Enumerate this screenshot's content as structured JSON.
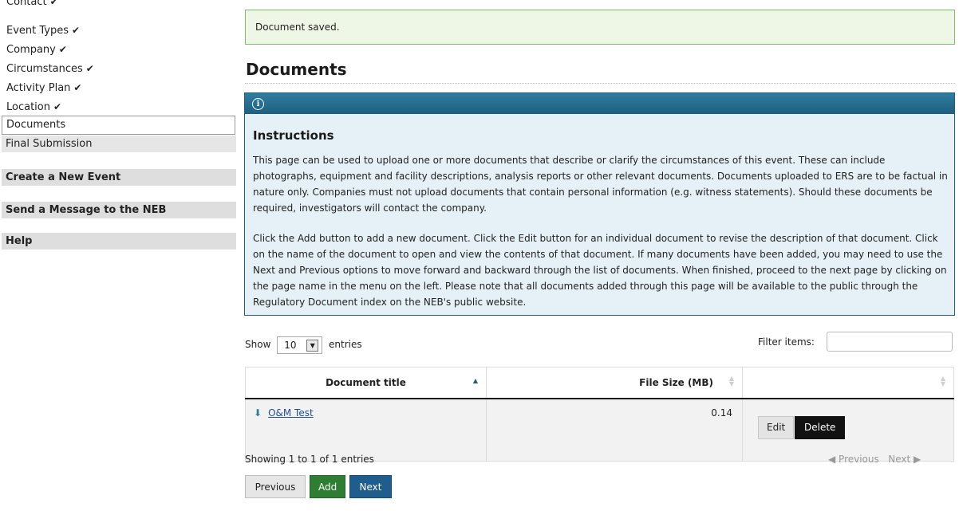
{
  "sidebar": {
    "nav": [
      {
        "label": "Contact",
        "check": "✔"
      },
      {
        "label": "Event Types",
        "check": "✔"
      },
      {
        "label": "Company",
        "check": "✔"
      },
      {
        "label": "Circumstances",
        "check": "✔"
      },
      {
        "label": "Activity Plan",
        "check": "✔"
      },
      {
        "label": "Location",
        "check": "✔"
      },
      {
        "label": "Documents",
        "check": ""
      },
      {
        "label": "Final Submission",
        "check": ""
      }
    ],
    "headings": [
      "Create a New Event",
      "Send a Message to the NEB",
      "Help"
    ]
  },
  "alert": {
    "message": "Document saved."
  },
  "page": {
    "title": "Documents"
  },
  "instructions": {
    "heading": "Instructions",
    "paragraph1": "This page can be used to upload one or more documents that describe or clarify the circumstances of this event. These can include photographs, equipment and facility descriptions, analysis reports or other relevant documents. Documents uploaded to ERS are to be factual in nature only. Companies must not upload documents that contain personal information (e.g. witness statements). Should these documents be required, investigators will contact the company.",
    "paragraph2": "Click the Add button to add a new document. Click the Edit button for an individual document to revise the description of that document. Click on the name of the document to open and view the contents of that document. If many documents have been added, you may need to use the Next and Previous options to move forward and backward through the list of documents. When finished, proceed to the next page by clicking on the page name in the menu on the left. Please note that all documents added through this page will be available to the public through the Regulatory Document index on the NEB's public website."
  },
  "table_controls": {
    "show_label": "Show",
    "entries_value": "10",
    "entries_label": "entries",
    "filter_label": "Filter items:"
  },
  "table": {
    "columns": [
      "Document title",
      "File Size (MB)",
      ""
    ],
    "rows": [
      {
        "title": "O&M Test",
        "size": "0.14",
        "edit": "Edit",
        "delete": "Delete"
      }
    ]
  },
  "footer": {
    "info": "Showing 1 to 1 of 1 entries",
    "prev": "◀ Previous",
    "next": "Next ▶"
  },
  "buttons": {
    "previous": "Previous",
    "add": "Add",
    "next": "Next"
  },
  "colors": {
    "accent": "#1f5d7a",
    "add": "#2f7d32",
    "next": "#1f5d8c",
    "success_border": "#7dba6c"
  }
}
